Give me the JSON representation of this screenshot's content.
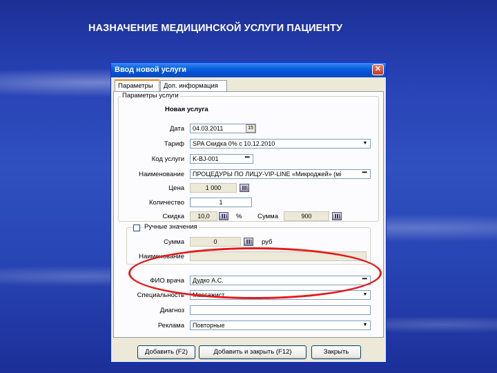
{
  "slide_title": "НАЗНАЧЕНИЕ МЕДИЦИНСКОЙ УСЛУГИ ПАЦИЕНТУ",
  "window": {
    "title": "Ввод новой услуги",
    "close_icon": "close-icon"
  },
  "tabs": [
    {
      "label": "Параметры",
      "active": true
    },
    {
      "label": "Доп. информация",
      "active": false
    }
  ],
  "group_params": {
    "legend": "Параметры услуги",
    "heading": "Новая услуга",
    "date": {
      "label": "Дата",
      "value": "04.03.2011"
    },
    "tariff": {
      "label": "Тариф",
      "value": "SPA Скидка 0% с 10.12.2010"
    },
    "service_code": {
      "label": "Код услуги",
      "value": "K-BJ-001"
    },
    "service_name": {
      "label": "Наименование",
      "value": "ПРОЦЕДУРЫ ПО ЛИЦУ-VIP-LINE «Микроджей» (мі"
    },
    "price": {
      "label": "Цена",
      "value": "1 000"
    },
    "quantity": {
      "label": "Количество",
      "value": "1"
    },
    "discount": {
      "label": "Скидка",
      "value": "10,0",
      "unit": "%"
    },
    "sum": {
      "label": "Сумма",
      "value": "900"
    }
  },
  "group_manual": {
    "legend": "Ручные значения",
    "checked": false,
    "sum": {
      "label": "Сумма",
      "value": "0",
      "unit": "руб"
    },
    "name": {
      "label": "Наименование",
      "value": ""
    }
  },
  "doctor": {
    "label": "ФИО врача",
    "value": "Дудко А.С."
  },
  "specialty": {
    "label": "Специальность",
    "value": "Массажист"
  },
  "diagnosis": {
    "label": "Диагноз",
    "value": ""
  },
  "advertising": {
    "label": "Реклама",
    "value": "Повторные"
  },
  "buttons": {
    "add": "Добавить (F2)",
    "add_close": "Добавить и закрыть (F12)",
    "close": "Закрыть"
  },
  "colors": {
    "highlight": "#e31b1b",
    "titlebar": "#0550d4"
  }
}
